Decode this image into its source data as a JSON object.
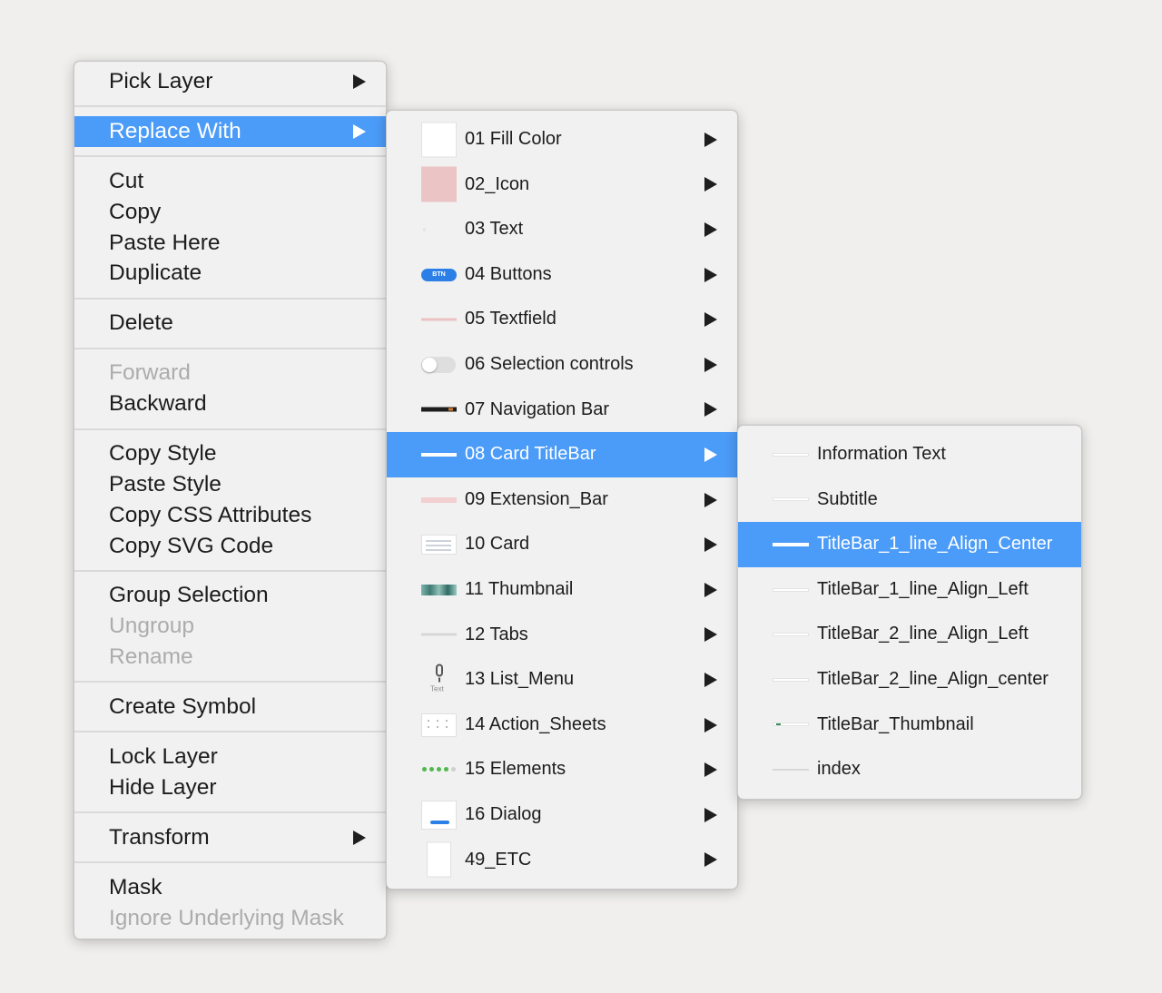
{
  "main_menu": {
    "pick_layer": "Pick Layer",
    "replace_with": "Replace With",
    "cut": "Cut",
    "copy": "Copy",
    "paste_here": "Paste Here",
    "duplicate": "Duplicate",
    "delete": "Delete",
    "forward": "Forward",
    "backward": "Backward",
    "copy_style": "Copy Style",
    "paste_style": "Paste Style",
    "copy_css": "Copy CSS Attributes",
    "copy_svg": "Copy SVG Code",
    "group_selection": "Group Selection",
    "ungroup": "Ungroup",
    "rename": "Rename",
    "create_symbol": "Create Symbol",
    "lock_layer": "Lock Layer",
    "hide_layer": "Hide Layer",
    "transform": "Transform",
    "mask": "Mask",
    "ignore_mask": "Ignore Underlying Mask"
  },
  "replace_menu": {
    "items": [
      {
        "label": "01 Fill Color",
        "icon": "fill-color-swatch"
      },
      {
        "label": "02_Icon",
        "icon": "icon-swatch"
      },
      {
        "label": "03 Text",
        "icon": "text-swatch"
      },
      {
        "label": "04 Buttons",
        "icon": "button-swatch",
        "icon_text": "BTN"
      },
      {
        "label": "05 Textfield",
        "icon": "textfield-swatch"
      },
      {
        "label": "06 Selection controls",
        "icon": "toggle-swatch"
      },
      {
        "label": "07 Navigation Bar",
        "icon": "navbar-swatch"
      },
      {
        "label": "08 Card TitleBar",
        "icon": "card-titlebar-swatch"
      },
      {
        "label": "09 Extension_Bar",
        "icon": "extension-bar-swatch"
      },
      {
        "label": "10 Card",
        "icon": "card-swatch"
      },
      {
        "label": "11 Thumbnail",
        "icon": "thumbnail-swatch"
      },
      {
        "label": "12 Tabs",
        "icon": "tabs-swatch"
      },
      {
        "label": "13 List_Menu",
        "icon": "microphone-icon",
        "icon_text": "Text"
      },
      {
        "label": "14 Action_Sheets",
        "icon": "action-sheet-swatch"
      },
      {
        "label": "15 Elements",
        "icon": "rating-dots-swatch"
      },
      {
        "label": "16 Dialog",
        "icon": "dialog-swatch"
      },
      {
        "label": "49_ETC",
        "icon": "etc-swatch"
      }
    ]
  },
  "titlebar_menu": {
    "items": [
      {
        "label": "Information Text"
      },
      {
        "label": "Subtitle"
      },
      {
        "label": "TitleBar_1_line_Align_Center"
      },
      {
        "label": "TitleBar_1_line_Align_Left"
      },
      {
        "label": "TitleBar_2_line_Align_Left"
      },
      {
        "label": "TitleBar_2_line_Align_center"
      },
      {
        "label": "TitleBar_Thumbnail"
      },
      {
        "label": "index"
      }
    ]
  },
  "colors": {
    "selection": "#4b9bf8",
    "menu_background": "#f1f1f1",
    "disabled_text": "#acacac",
    "desktop": "#f0efee"
  }
}
